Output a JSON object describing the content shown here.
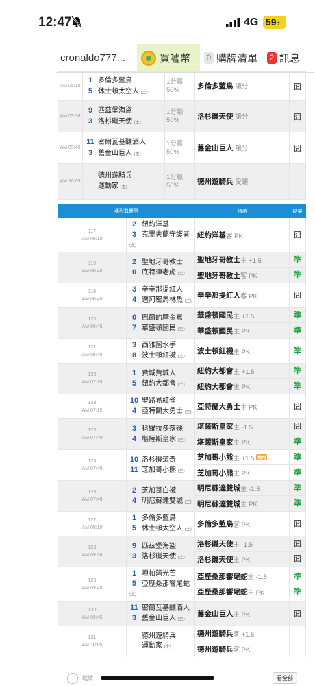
{
  "status": {
    "time": "12:47",
    "network": "4G",
    "battery": "59"
  },
  "tabs": {
    "user": "cronaldo777...",
    "buy": "買噓幣",
    "list_count": "0",
    "list": "購牌清單",
    "msg_count": "2",
    "msg": "訊息"
  },
  "top_rows": [
    {
      "time": "AM 08:10",
      "t1": "多倫多藍鳥",
      "t1_tag": "",
      "s1": "1",
      "t2": "休士頓太空人",
      "t2_tag": "(主)",
      "s2": "5",
      "result": "1分贏\n50%",
      "pick": "多倫多藍鳥",
      "pick_hint": "讓分",
      "outcome": "囧",
      "grey": false
    },
    {
      "time": "AM 09:38",
      "t1": "匹茲堡海盜",
      "t1_tag": "",
      "s1": "9",
      "t2": "洛杉磯天使",
      "t2_tag": "(主)",
      "s2": "3",
      "result": "1分輸\n50%",
      "pick": "洛杉磯天使",
      "pick_hint": "讓分",
      "outcome": "囧",
      "grey": true
    },
    {
      "time": "AM 09:45",
      "t1": "密爾瓦基釀酒人",
      "t1_tag": "",
      "s1": "11",
      "t2": "舊金山巨人",
      "t2_tag": "(主)",
      "s2": "3",
      "result": "1分贏\n50%",
      "pick": "舊金山巨人",
      "pick_hint": "讓分",
      "outcome": "囧",
      "grey": false
    },
    {
      "time": "AM 10:05",
      "t1": "德州遊騎兵",
      "t1_tag": "",
      "s1": "",
      "t2": "運動家",
      "t2_tag": "(主)",
      "s2": "",
      "result": "1分贏\n50%",
      "pick": "德州遊騎兵",
      "pick_hint": "受讓",
      "outcome": "",
      "grey": true
    }
  ],
  "section": {
    "games_header": "運彩盤賽事",
    "pred_header": "預測",
    "result_header": "結果"
  },
  "games": [
    {
      "no": "117",
      "time": "AM 06:10",
      "t1": "紐約洋基",
      "s1": "2",
      "t2": "克里夫蘭守護者",
      "s2": "3",
      "grey": false,
      "bets": [
        {
          "team": "紐約洋基",
          "hint": "客 PK",
          "hot": "",
          "res": "囧"
        }
      ]
    },
    {
      "no": "119",
      "time": "AM 06:40",
      "t1": "聖地牙哥教士",
      "s1": "2",
      "t2": "底特律老虎",
      "s2": "0",
      "grey": true,
      "bets": [
        {
          "team": "聖地牙哥教士",
          "hint": "主 +1.5",
          "hot": "",
          "res": "準"
        },
        {
          "team": "聖地牙哥教士",
          "hint": "客 PK",
          "hot": "",
          "res": "準"
        }
      ]
    },
    {
      "no": "118",
      "time": "AM 06:40",
      "t1": "辛辛那提紅人",
      "s1": "3",
      "t2": "邁阿密馬林魚",
      "s2": "4",
      "grey": false,
      "bets": [
        {
          "team": "辛辛那提紅人",
          "hint": "客 PK",
          "hot": "",
          "res": "囧"
        }
      ]
    },
    {
      "no": "120",
      "time": "AM 06:45",
      "t1": "巴爾的摩金鶯",
      "s1": "0",
      "t2": "華盛頓國民",
      "s2": "7",
      "grey": true,
      "bets": [
        {
          "team": "華盛頓國民",
          "hint": "主 +1.5",
          "hot": "",
          "res": "準"
        },
        {
          "team": "華盛頓國民",
          "hint": "主 PK",
          "hot": "",
          "res": "準"
        }
      ]
    },
    {
      "no": "121",
      "time": "AM 06:45",
      "t1": "西雅圖水手",
      "s1": "3",
      "t2": "波士頓紅襪",
      "s2": "8",
      "grey": false,
      "bets": [
        {
          "team": "波士頓紅襪",
          "hint": "主 PK",
          "hot": "",
          "res": "準"
        }
      ]
    },
    {
      "no": "122",
      "time": "AM 07:10",
      "t1": "費城費城人",
      "s1": "1",
      "t2": "紐約大都會",
      "s2": "5",
      "grey": true,
      "bets": [
        {
          "team": "紐約大都會",
          "hint": "主 +1.5",
          "hot": "",
          "res": "準"
        },
        {
          "team": "紐約大都會",
          "hint": "主 PK",
          "hot": "",
          "res": "準"
        }
      ]
    },
    {
      "no": "139",
      "time": "AM 07:15",
      "t1": "聖路易紅雀",
      "s1": "10",
      "t2": "亞特蘭大勇士",
      "s2": "4",
      "grey": false,
      "bets": [
        {
          "team": "亞特蘭大勇士",
          "hint": "主 PK",
          "hot": "",
          "res": "囧"
        }
      ]
    },
    {
      "no": "125",
      "time": "AM 07:40",
      "t1": "科羅拉多落磯",
      "s1": "3",
      "t2": "堪薩斯皇家",
      "s2": "4",
      "grey": true,
      "bets": [
        {
          "team": "堪薩斯皇家",
          "hint": "主 -1.5",
          "hot": "",
          "res": "囧"
        },
        {
          "team": "堪薩斯皇家",
          "hint": "主 PK",
          "hot": "",
          "res": "準"
        }
      ]
    },
    {
      "no": "124",
      "time": "AM 07:40",
      "t1": "洛杉磯道奇",
      "s1": "10",
      "t2": "芝加哥小熊",
      "s2": "11",
      "grey": false,
      "bets": [
        {
          "team": "芝加哥小熊",
          "hint": "主 +1.5",
          "hot": "熱門",
          "res": "準"
        },
        {
          "team": "芝加哥小熊",
          "hint": "主 PK",
          "hot": "",
          "res": "準"
        }
      ]
    },
    {
      "no": "123",
      "time": "AM 07:40",
      "t1": "芝加哥白襪",
      "s1": "2",
      "t2": "明尼蘇達雙城",
      "s2": "4",
      "grey": true,
      "bets": [
        {
          "team": "明尼蘇達雙城",
          "hint": "主 -1.5",
          "hot": "",
          "res": "準"
        },
        {
          "team": "明尼蘇達雙城",
          "hint": "主 PK",
          "hot": "",
          "res": "準"
        }
      ]
    },
    {
      "no": "127",
      "time": "AM 08:10",
      "t1": "多倫多藍鳥",
      "s1": "1",
      "t2": "休士頓太空人",
      "s2": "5",
      "grey": false,
      "bets": [
        {
          "team": "多倫多藍鳥",
          "hint": "客 PK",
          "hot": "",
          "res": "囧"
        }
      ]
    },
    {
      "no": "128",
      "time": "AM 09:38",
      "t1": "匹茲堡海盜",
      "s1": "9",
      "t2": "洛杉磯天使",
      "s2": "3",
      "grey": true,
      "bets": [
        {
          "team": "洛杉磯天使",
          "hint": "主 -1.5",
          "hot": "",
          "res": "囧"
        },
        {
          "team": "洛杉磯天使",
          "hint": "主 PK",
          "hot": "",
          "res": "囧"
        }
      ]
    },
    {
      "no": "129",
      "time": "AM 09:40",
      "t1": "坦帕灣光芒",
      "s1": "1",
      "t2": "亞歷桑那響尾蛇",
      "s2": "5",
      "grey": false,
      "bets": [
        {
          "team": "亞歷桑那響尾蛇",
          "hint": "主 -1.5",
          "hot": "",
          "res": "準"
        },
        {
          "team": "亞歷桑那響尾蛇",
          "hint": "主 PK",
          "hot": "",
          "res": "準"
        }
      ]
    },
    {
      "no": "130",
      "time": "AM 09:45",
      "t1": "密爾瓦基釀酒人",
      "s1": "11",
      "t2": "舊金山巨人",
      "s2": "3",
      "grey": true,
      "bets": [
        {
          "team": "舊金山巨人",
          "hint": "主 PK",
          "hot": "",
          "res": "囧"
        }
      ]
    },
    {
      "no": "131",
      "time": "AM 10:05",
      "t1": "德州遊騎兵",
      "s1": "",
      "t2": "運動家",
      "s2": "",
      "grey": false,
      "bets": [
        {
          "team": "德州遊騎兵",
          "hint": "客 +1.5",
          "hot": "",
          "res": ""
        },
        {
          "team": "德州遊騎兵",
          "hint": "客 PK",
          "hot": "",
          "res": ""
        }
      ]
    }
  ],
  "home_tag": "(主)",
  "footer": {
    "label": "戰績",
    "button": "看全部"
  },
  "colors": {
    "header_blue": "#1a8fd6",
    "win_green": "#19a33a",
    "score_blue": "#2a5db0",
    "buy_tab_bg": "#e8f3c8"
  }
}
